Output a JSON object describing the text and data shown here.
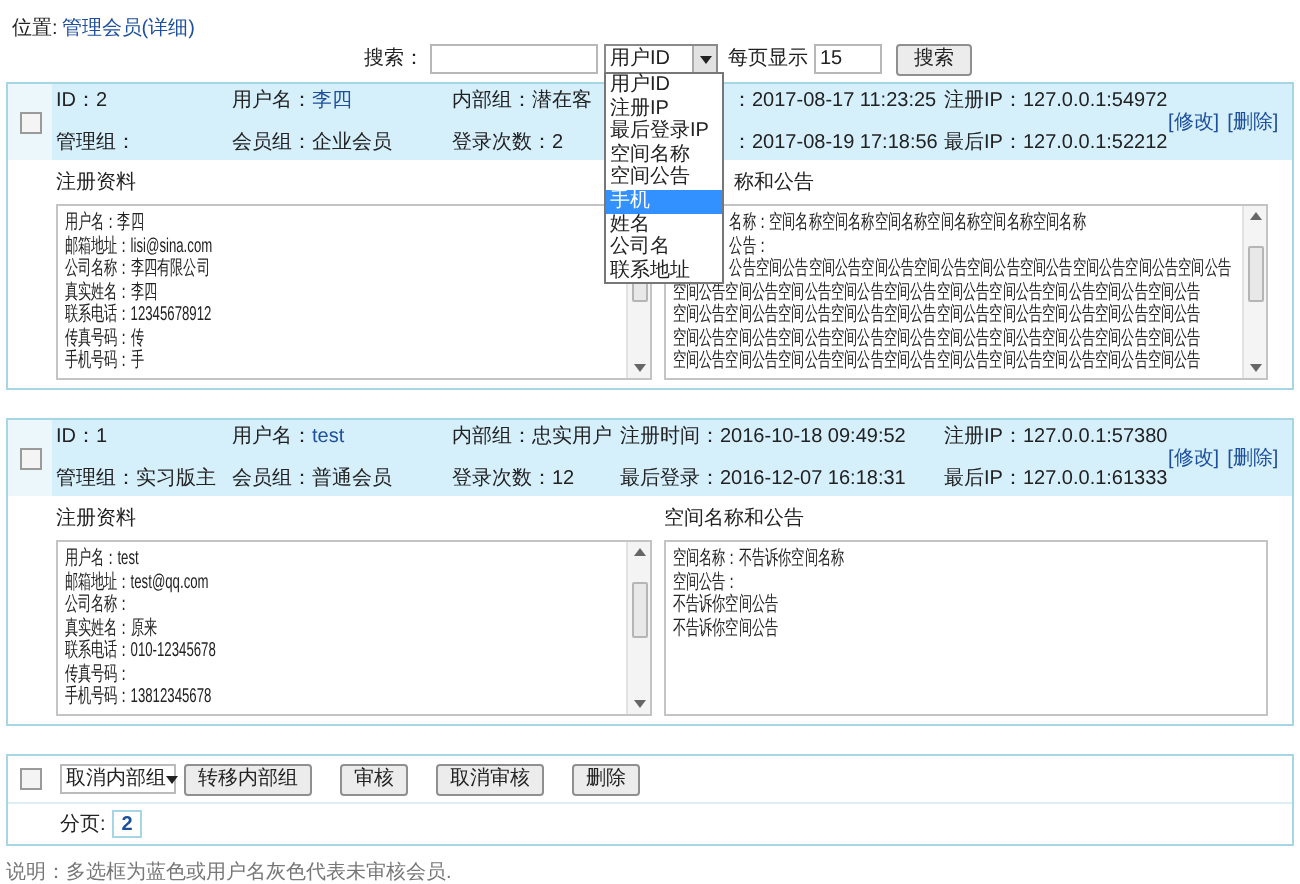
{
  "breadcrumb": {
    "label": "位置:",
    "link": "管理会员(详细)"
  },
  "search": {
    "label": "搜索：",
    "select": {
      "value": "用户ID",
      "expanded": true,
      "options": [
        {
          "label": "用户ID",
          "highlighted": false
        },
        {
          "label": "注册IP",
          "highlighted": false
        },
        {
          "label": "最后登录IP",
          "highlighted": false
        },
        {
          "label": "空间名称",
          "highlighted": false
        },
        {
          "label": "空间公告",
          "highlighted": false
        },
        {
          "label": "手机",
          "highlighted": true
        },
        {
          "label": "姓名",
          "highlighted": false
        },
        {
          "label": "公司名",
          "highlighted": false
        },
        {
          "label": "联系地址",
          "highlighted": false
        }
      ]
    },
    "per_page_label": "每页显示",
    "per_page": "15",
    "button": "搜索"
  },
  "members": [
    {
      "checked": false,
      "actions": [
        "[修改]",
        "[删除]"
      ],
      "header_rows": [
        [
          {
            "kind": "plain",
            "value": "ID：2"
          },
          {
            "kind": "link",
            "label": "用户名：",
            "value": "李四"
          },
          {
            "kind": "plain",
            "value": "内部组：潜在客"
          },
          {
            "kind": "covered",
            "value": "：2017-08-17 11:23:25"
          },
          {
            "kind": "plain",
            "value": "注册IP：127.0.0.1:54972"
          }
        ],
        [
          {
            "kind": "plain",
            "value": "管理组："
          },
          {
            "kind": "plain",
            "value": "会员组：企业会员"
          },
          {
            "kind": "plain",
            "value": "登录次数：2"
          },
          {
            "kind": "covered",
            "value": "：2017-08-19 17:18:56"
          },
          {
            "kind": "plain",
            "value": "最后IP：127.0.0.1:52212"
          }
        ]
      ],
      "sections": [
        {
          "title": {
            "kind": "plain",
            "text": "注册资料"
          },
          "lines": [
            {
              "kind": "plain",
              "text": "用户名：李四"
            },
            {
              "kind": "plain",
              "text": "邮箱地址：lisi@sina.com"
            },
            {
              "kind": "plain",
              "text": "公司名称：李四有限公司"
            },
            {
              "kind": "plain",
              "text": "真实姓名：李四"
            },
            {
              "kind": "plain",
              "text": "联系电话：12345678912"
            },
            {
              "kind": "plain",
              "text": "传真号码：传"
            },
            {
              "kind": "plain",
              "text": "手机号码：手"
            }
          ]
        },
        {
          "title": {
            "kind": "covered",
            "text": "称和公告"
          },
          "lines": [
            {
              "kind": "covered",
              "text": "名称：空间名称空间名称空间名称空间名称空间名称空间名称"
            },
            {
              "kind": "covered",
              "text": "公告："
            },
            {
              "kind": "covered",
              "text": "公告空间公告空间公告空间公告空间公告空间公告空间公告空间公告空间公告空间公告"
            },
            {
              "kind": "plain",
              "text": "空间公告空间公告空间公告空间公告空间公告空间公告空间公告空间公告空间公告空间公告"
            },
            {
              "kind": "plain",
              "text": "空间公告空间公告空间公告空间公告空间公告空间公告空间公告空间公告空间公告空间公告"
            },
            {
              "kind": "plain",
              "text": "空间公告空间公告空间公告空间公告空间公告空间公告空间公告空间公告空间公告空间公告"
            },
            {
              "kind": "plain",
              "text": "空间公告空间公告空间公告空间公告空间公告空间公告空间公告空间公告空间公告空间公告"
            }
          ]
        }
      ]
    },
    {
      "checked": false,
      "actions": [
        "[修改]",
        "[删除]"
      ],
      "header_rows": [
        [
          {
            "kind": "plain",
            "value": "ID：1"
          },
          {
            "kind": "link",
            "label": "用户名：",
            "value": "test"
          },
          {
            "kind": "plain",
            "value": "内部组：忠实用户"
          },
          {
            "kind": "plain",
            "value": "注册时间：2016-10-18 09:49:52"
          },
          {
            "kind": "plain",
            "value": "注册IP：127.0.0.1:57380"
          }
        ],
        [
          {
            "kind": "plain",
            "value": "管理组：实习版主"
          },
          {
            "kind": "plain",
            "value": "会员组：普通会员"
          },
          {
            "kind": "plain",
            "value": "登录次数：12"
          },
          {
            "kind": "plain",
            "value": "最后登录：2016-12-07 16:18:31"
          },
          {
            "kind": "plain",
            "value": "最后IP：127.0.0.1:61333"
          }
        ]
      ],
      "sections": [
        {
          "title": {
            "kind": "plain",
            "text": "注册资料"
          },
          "lines": [
            {
              "kind": "plain",
              "text": "用户名：test"
            },
            {
              "kind": "plain",
              "text": "邮箱地址：test@qq.com"
            },
            {
              "kind": "plain",
              "text": "公司名称："
            },
            {
              "kind": "plain",
              "text": "真实姓名：原来"
            },
            {
              "kind": "plain",
              "text": "联系电话：010-12345678"
            },
            {
              "kind": "plain",
              "text": "传真号码："
            },
            {
              "kind": "plain",
              "text": "手机号码：13812345678"
            }
          ]
        },
        {
          "title": {
            "kind": "plain",
            "text": "空间名称和公告"
          },
          "lines": [
            {
              "kind": "plain",
              "text": "空间名称：不告诉你空间名称"
            },
            {
              "kind": "plain",
              "text": "空间公告："
            },
            {
              "kind": "plain",
              "text": "不告诉你空间公告"
            },
            {
              "kind": "plain",
              "text": "不告诉你空间公告"
            }
          ]
        }
      ]
    }
  ],
  "toolbar": {
    "checked": false,
    "group_select": "取消内部组",
    "buttons": [
      "转移内部组",
      "审核",
      "取消审核",
      "删除"
    ],
    "pages_label": "分页:",
    "pages": [
      {
        "label": "2",
        "selected": true
      }
    ]
  },
  "note": "说明：多选框为蓝色或用户名灰色代表未审核会员."
}
